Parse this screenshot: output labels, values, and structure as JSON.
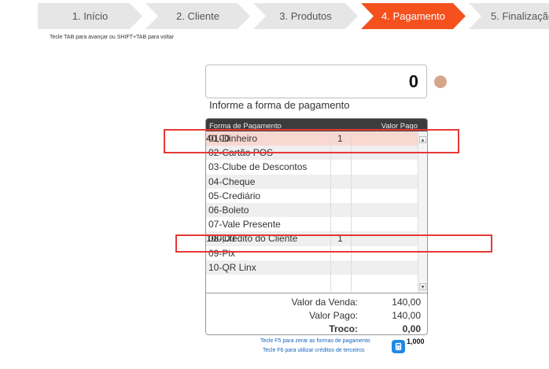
{
  "steps": [
    {
      "label": "1. Início",
      "active": false
    },
    {
      "label": "2. Cliente",
      "active": false
    },
    {
      "label": "3. Produtos",
      "active": false
    },
    {
      "label": "4. Pagamento",
      "active": true
    },
    {
      "label": "5. Finalização",
      "active": false
    }
  ],
  "hint_top": "Tecle TAB para avançar ou SHIFT+TAB para voltar",
  "amount_value": "0",
  "prompt": "Informe a forma de pagamento",
  "table": {
    "col_name": "Forma de Pagamento",
    "col_value": "Valor Pago",
    "rows": [
      {
        "name": "01-Dinheiro",
        "qty": "1",
        "value": "40,00",
        "selected": true
      },
      {
        "name": "02-Cartão POS",
        "qty": "",
        "value": "",
        "selected": false
      },
      {
        "name": "03-Clube de Descontos",
        "qty": "",
        "value": "",
        "selected": false
      },
      {
        "name": "04-Cheque",
        "qty": "",
        "value": "",
        "selected": false
      },
      {
        "name": "05-Crediário",
        "qty": "",
        "value": "",
        "selected": false
      },
      {
        "name": "06-Boleto",
        "qty": "",
        "value": "",
        "selected": false
      },
      {
        "name": "07-Vale Presente",
        "qty": "",
        "value": "",
        "selected": false
      },
      {
        "name": "08-Crédito do Cliente",
        "qty": "1",
        "value": "100,00",
        "selected": false
      },
      {
        "name": "09-Pix",
        "qty": "",
        "value": "",
        "selected": false
      },
      {
        "name": "10-QR Linx",
        "qty": "",
        "value": "",
        "selected": false
      },
      {
        "name": "",
        "qty": "",
        "value": "",
        "selected": false
      }
    ]
  },
  "summary": {
    "sale_label": "Valor da Venda:",
    "sale_value": "140,00",
    "paid_label": "Valor Pago:",
    "paid_value": "140,00",
    "change_label": "Troco:",
    "change_value": "0,00"
  },
  "hint_f5": "Tecle F5 para zerar as formas de pagamento",
  "hint_f6": "Tecle F6 para utilizar créditos de terceiros",
  "credit_amount": "1,000",
  "icons": {
    "calculator": "calculator-icon",
    "status": "status-dot"
  },
  "colors": {
    "active_step": "#f4511e",
    "selected_row": "#f9d8d2",
    "annotation": "#e53935",
    "link": "#1565c0"
  }
}
